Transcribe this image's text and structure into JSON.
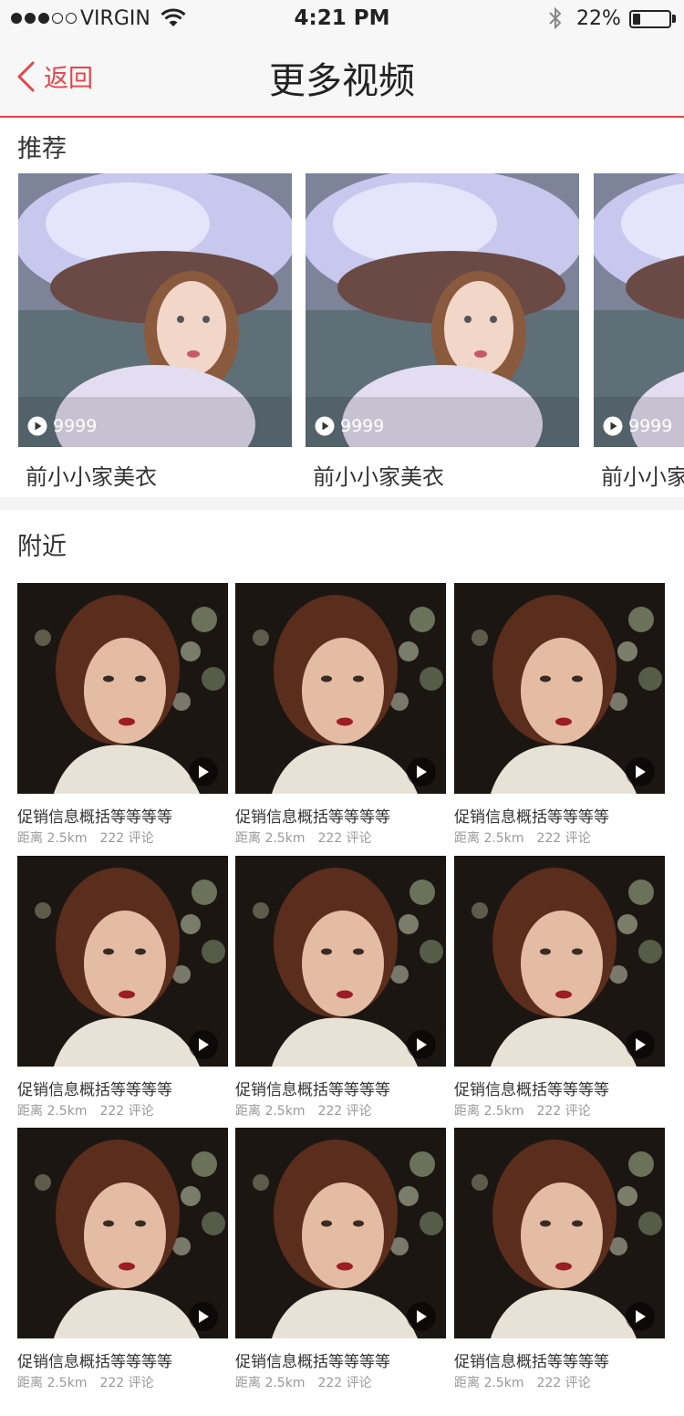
{
  "status_bar": {
    "carrier": "VIRGIN",
    "time": "4:21 PM",
    "battery_percent_text": "22%",
    "battery_level": 0.22,
    "signal_strength": 3,
    "signal_total": 5
  },
  "nav": {
    "back_label": "返回",
    "title": "更多视频",
    "accent_color": "#e5454b"
  },
  "recommend": {
    "section_title": "推荐",
    "items": [
      {
        "play_count": "9999",
        "caption": "前小小家美衣"
      },
      {
        "play_count": "9999",
        "caption": "前小小家美衣"
      },
      {
        "play_count": "9999",
        "caption": "前小小家"
      }
    ]
  },
  "nearby": {
    "section_title": "附近",
    "items": [
      {
        "title": "促销信息概括等等等等",
        "distance": "距离 2.5km",
        "comments": "222 评论"
      },
      {
        "title": "促销信息概括等等等等",
        "distance": "距离 2.5km",
        "comments": "222 评论"
      },
      {
        "title": "促销信息概括等等等等",
        "distance": "距离 2.5km",
        "comments": "222 评论"
      },
      {
        "title": "促销信息概括等等等等",
        "distance": "距离 2.5km",
        "comments": "222 评论"
      },
      {
        "title": "促销信息概括等等等等",
        "distance": "距离 2.5km",
        "comments": "222 评论"
      },
      {
        "title": "促销信息概括等等等等",
        "distance": "距离 2.5km",
        "comments": "222 评论"
      },
      {
        "title": "促销信息概括等等等等",
        "distance": "距离 2.5km",
        "comments": "222 评论"
      },
      {
        "title": "促销信息概括等等等等",
        "distance": "距离 2.5km",
        "comments": "222 评论"
      },
      {
        "title": "促销信息概括等等等等",
        "distance": "距离 2.5km",
        "comments": "222 评论"
      }
    ]
  }
}
